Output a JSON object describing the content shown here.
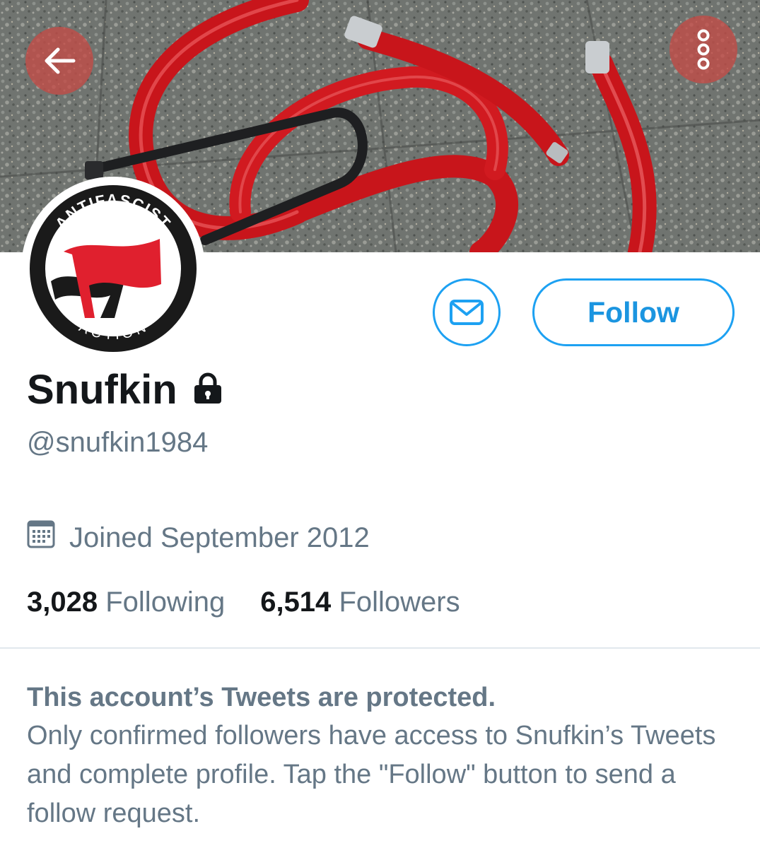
{
  "header": {
    "back_icon": "arrow-left-icon",
    "more_icon": "more-vertical-icon",
    "accent_color": "#1da1f2"
  },
  "avatar": {
    "top_text": "ANTIFASCIST",
    "bottom_text": "ACTION"
  },
  "actions": {
    "message_icon": "envelope-icon",
    "follow_label": "Follow"
  },
  "profile": {
    "name": "Snufkin",
    "protected_icon": "lock-icon",
    "handle": "@snufkin1984",
    "joined_icon": "calendar-icon",
    "joined": "Joined September 2012"
  },
  "stats": {
    "following_count": "3,028",
    "following_label": "Following",
    "followers_count": "6,514",
    "followers_label": "Followers"
  },
  "protected_notice": {
    "title": "This account’s Tweets are protected.",
    "body": "Only confirmed followers have access to Snufkin’s Tweets and complete profile. Tap the \"Follow\" button to send a follow request."
  }
}
